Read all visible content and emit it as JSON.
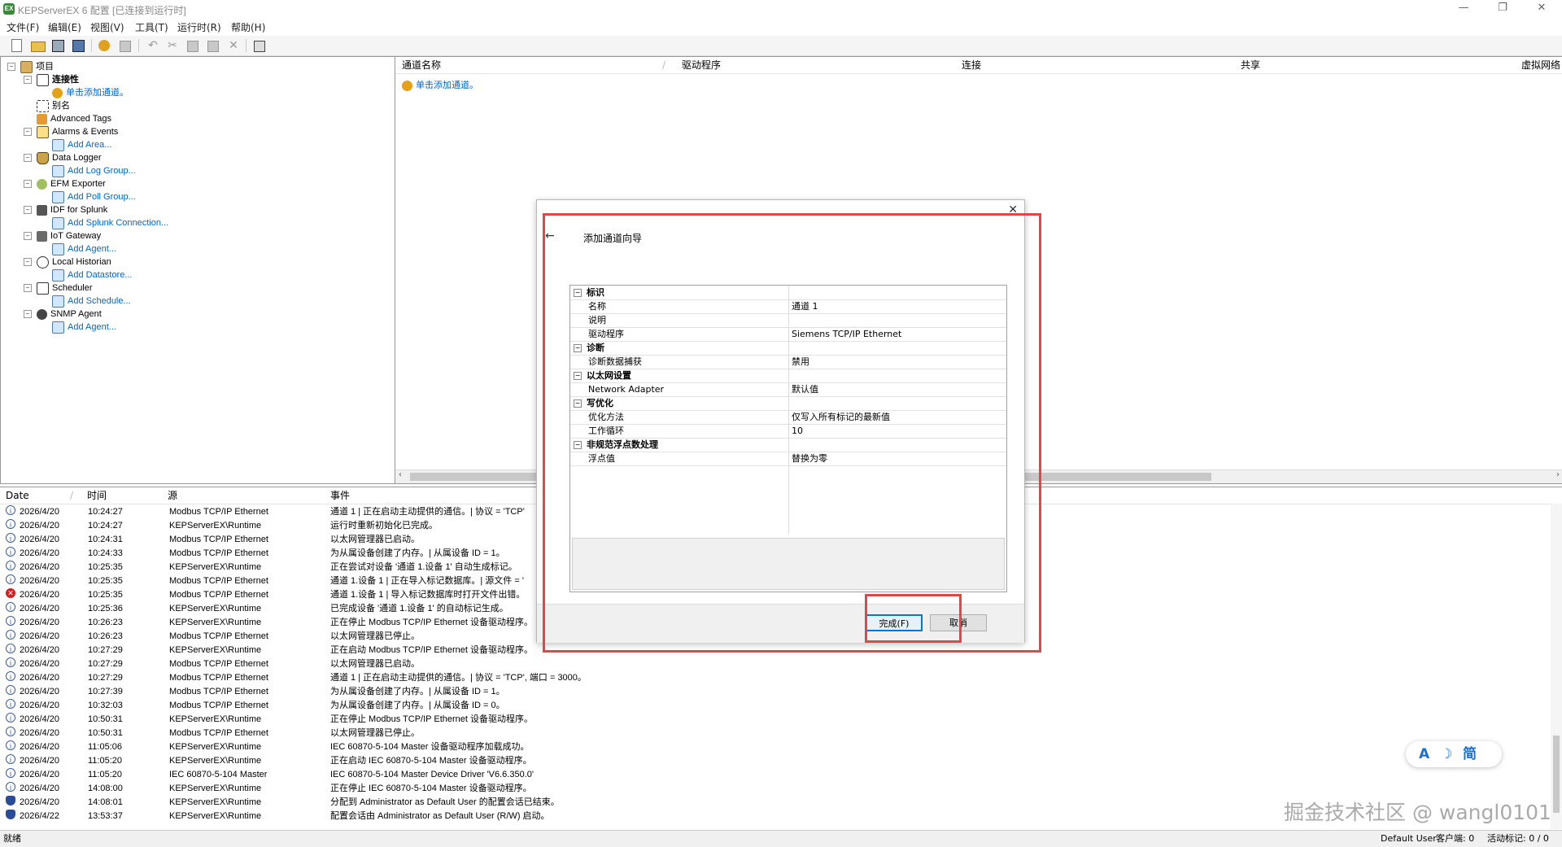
{
  "window": {
    "title": "KEPServerEX 6 配置 [已连接到运行时]",
    "app_icon_text": "EX",
    "controls": {
      "minimize": "—",
      "restore": "❐",
      "close": "✕"
    }
  },
  "menu": [
    "文件(F)",
    "编辑(E)",
    "视图(V)",
    "工具(T)",
    "运行时(R)",
    "帮助(H)"
  ],
  "tree": [
    {
      "label": "项目",
      "icon": "project-icon",
      "bold": false,
      "link": false,
      "expander": "-"
    },
    {
      "label": "连接性",
      "icon": "connectivity-icon",
      "bold": true,
      "link": false,
      "expander": "-"
    },
    {
      "label": "单击添加通道。",
      "icon": "add-channel-icon",
      "bold": false,
      "link": true,
      "expander": ""
    },
    {
      "label": "别名",
      "icon": "alias-icon",
      "bold": false,
      "link": false,
      "expander": ""
    },
    {
      "label": "Advanced Tags",
      "icon": "advanced-tags-icon",
      "bold": false,
      "link": false,
      "expander": ""
    },
    {
      "label": "Alarms & Events",
      "icon": "alarms-icon",
      "bold": false,
      "link": false,
      "expander": "-"
    },
    {
      "label": "Add Area...",
      "icon": "add-icon",
      "bold": false,
      "link": true,
      "expander": ""
    },
    {
      "label": "Data Logger",
      "icon": "data-logger-icon",
      "bold": false,
      "link": false,
      "expander": "-"
    },
    {
      "label": "Add Log Group...",
      "icon": "add-icon",
      "bold": false,
      "link": true,
      "expander": ""
    },
    {
      "label": "EFM Exporter",
      "icon": "efm-icon",
      "bold": false,
      "link": false,
      "expander": "-"
    },
    {
      "label": "Add Poll Group...",
      "icon": "add-icon",
      "bold": false,
      "link": true,
      "expander": ""
    },
    {
      "label": "IDF for Splunk",
      "icon": "splunk-icon",
      "bold": false,
      "link": false,
      "expander": "-"
    },
    {
      "label": "Add Splunk Connection...",
      "icon": "add-icon",
      "bold": false,
      "link": true,
      "expander": ""
    },
    {
      "label": "IoT Gateway",
      "icon": "iot-icon",
      "bold": false,
      "link": false,
      "expander": "-"
    },
    {
      "label": "Add Agent...",
      "icon": "add-icon",
      "bold": false,
      "link": true,
      "expander": ""
    },
    {
      "label": "Local Historian",
      "icon": "historian-icon",
      "bold": false,
      "link": false,
      "expander": "-"
    },
    {
      "label": "Add Datastore...",
      "icon": "add-icon",
      "bold": false,
      "link": true,
      "expander": ""
    },
    {
      "label": "Scheduler",
      "icon": "scheduler-icon",
      "bold": false,
      "link": false,
      "expander": "-"
    },
    {
      "label": "Add Schedule...",
      "icon": "add-icon",
      "bold": false,
      "link": true,
      "expander": ""
    },
    {
      "label": "SNMP Agent",
      "icon": "snmp-icon",
      "bold": false,
      "link": false,
      "expander": "-"
    },
    {
      "label": "Add Agent...",
      "icon": "add-icon",
      "bold": false,
      "link": true,
      "expander": ""
    }
  ],
  "channels": {
    "columns": [
      "通道名称",
      "驱动程序",
      "连接",
      "共享",
      "虚拟网络"
    ],
    "add_link": "单击添加通道。"
  },
  "log": {
    "columns": [
      "Date",
      "时间",
      "源",
      "事件"
    ],
    "rows": [
      {
        "level": "info",
        "date": "2026/4/20",
        "time": "10:24:27",
        "source": "Modbus TCP/IP Ethernet",
        "event": "通道 1 | 正在启动主动提供的通信。| 协议 = 'TCP'"
      },
      {
        "level": "info",
        "date": "2026/4/20",
        "time": "10:24:27",
        "source": "KEPServerEX\\Runtime",
        "event": "运行时重新初始化已完成。"
      },
      {
        "level": "info",
        "date": "2026/4/20",
        "time": "10:24:31",
        "source": "Modbus TCP/IP Ethernet",
        "event": "以太网管理器已启动。"
      },
      {
        "level": "info",
        "date": "2026/4/20",
        "time": "10:24:33",
        "source": "Modbus TCP/IP Ethernet",
        "event": "为从属设备创建了内存。| 从属设备 ID = 1。"
      },
      {
        "level": "info",
        "date": "2026/4/20",
        "time": "10:25:35",
        "source": "KEPServerEX\\Runtime",
        "event": "正在尝试对设备 '通道 1.设备 1' 自动生成标记。"
      },
      {
        "level": "info",
        "date": "2026/4/20",
        "time": "10:25:35",
        "source": "Modbus TCP/IP Ethernet",
        "event": "通道 1.设备 1 | 正在导入标记数据库。| 源文件 = '"
      },
      {
        "level": "error",
        "date": "2026/4/20",
        "time": "10:25:35",
        "source": "Modbus TCP/IP Ethernet",
        "event": "通道 1.设备 1 | 导入标记数据库时打开文件出错。"
      },
      {
        "level": "info",
        "date": "2026/4/20",
        "time": "10:25:36",
        "source": "KEPServerEX\\Runtime",
        "event": "已完成设备 '通道 1.设备 1' 的自动标记生成。"
      },
      {
        "level": "info",
        "date": "2026/4/20",
        "time": "10:26:23",
        "source": "KEPServerEX\\Runtime",
        "event": "正在停止 Modbus TCP/IP Ethernet 设备驱动程序。"
      },
      {
        "level": "info",
        "date": "2026/4/20",
        "time": "10:26:23",
        "source": "Modbus TCP/IP Ethernet",
        "event": "以太网管理器已停止。"
      },
      {
        "level": "info",
        "date": "2026/4/20",
        "time": "10:27:29",
        "source": "KEPServerEX\\Runtime",
        "event": "正在启动 Modbus TCP/IP Ethernet 设备驱动程序。"
      },
      {
        "level": "info",
        "date": "2026/4/20",
        "time": "10:27:29",
        "source": "Modbus TCP/IP Ethernet",
        "event": "以太网管理器已启动。"
      },
      {
        "level": "info",
        "date": "2026/4/20",
        "time": "10:27:29",
        "source": "Modbus TCP/IP Ethernet",
        "event": "通道 1 | 正在启动主动提供的通信。| 协议 = 'TCP', 端口 = 3000。"
      },
      {
        "level": "info",
        "date": "2026/4/20",
        "time": "10:27:39",
        "source": "Modbus TCP/IP Ethernet",
        "event": "为从属设备创建了内存。| 从属设备 ID = 1。"
      },
      {
        "level": "info",
        "date": "2026/4/20",
        "time": "10:32:03",
        "source": "Modbus TCP/IP Ethernet",
        "event": "为从属设备创建了内存。| 从属设备 ID = 0。"
      },
      {
        "level": "info",
        "date": "2026/4/20",
        "time": "10:50:31",
        "source": "KEPServerEX\\Runtime",
        "event": "正在停止 Modbus TCP/IP Ethernet 设备驱动程序。"
      },
      {
        "level": "info",
        "date": "2026/4/20",
        "time": "10:50:31",
        "source": "Modbus TCP/IP Ethernet",
        "event": "以太网管理器已停止。"
      },
      {
        "level": "info",
        "date": "2026/4/20",
        "time": "11:05:06",
        "source": "KEPServerEX\\Runtime",
        "event": "IEC 60870-5-104 Master 设备驱动程序加载成功。"
      },
      {
        "level": "info",
        "date": "2026/4/20",
        "time": "11:05:20",
        "source": "KEPServerEX\\Runtime",
        "event": "正在启动 IEC 60870-5-104 Master 设备驱动程序。"
      },
      {
        "level": "info",
        "date": "2026/4/20",
        "time": "11:05:20",
        "source": "IEC 60870-5-104 Master",
        "event": "IEC 60870-5-104 Master Device Driver 'V6.6.350.0'"
      },
      {
        "level": "info",
        "date": "2026/4/20",
        "time": "14:08:00",
        "source": "KEPServerEX\\Runtime",
        "event": "正在停止 IEC 60870-5-104 Master 设备驱动程序。"
      },
      {
        "level": "security",
        "date": "2026/4/20",
        "time": "14:08:01",
        "source": "KEPServerEX\\Runtime",
        "event": "分配到 Administrator as Default User 的配置会话已结束。"
      },
      {
        "level": "security",
        "date": "2026/4/22",
        "time": "13:53:37",
        "source": "KEPServerEX\\Runtime",
        "event": "配置会话由 Administrator as Default User (R/W) 启动。"
      }
    ]
  },
  "status": {
    "left": "就绪",
    "user": "Default User",
    "clients": "客户端: 0",
    "tags": "活动标记: 0 / 0"
  },
  "dialog": {
    "title": "添加通道向导",
    "back_icon": "←",
    "close_icon": "✕",
    "properties": [
      {
        "type": "category",
        "name": "标识"
      },
      {
        "type": "prop",
        "name": "名称",
        "value": "通道 1"
      },
      {
        "type": "prop",
        "name": "说明",
        "value": ""
      },
      {
        "type": "prop",
        "name": "驱动程序",
        "value": "Siemens TCP/IP Ethernet"
      },
      {
        "type": "category",
        "name": "诊断"
      },
      {
        "type": "prop",
        "name": "诊断数据捕获",
        "value": "禁用"
      },
      {
        "type": "category",
        "name": "以太网设置"
      },
      {
        "type": "prop",
        "name": "Network Adapter",
        "value": "默认值"
      },
      {
        "type": "category",
        "name": "写优化"
      },
      {
        "type": "prop",
        "name": "优化方法",
        "value": "仅写入所有标记的最新值"
      },
      {
        "type": "prop",
        "name": "工作循环",
        "value": "10"
      },
      {
        "type": "category",
        "name": "非规范浮点数处理"
      },
      {
        "type": "prop",
        "name": "浮点值",
        "value": "替换为零"
      }
    ],
    "finish_label": "完成(F)",
    "cancel_label": "取消"
  },
  "ime": {
    "a": "A",
    "moon": "☽",
    "mode": "简"
  },
  "watermark": "掘金技术社区 @ wangl0101",
  "colors": {
    "highlight": "#e04848",
    "link": "#0066cc",
    "error": "#d02020"
  }
}
